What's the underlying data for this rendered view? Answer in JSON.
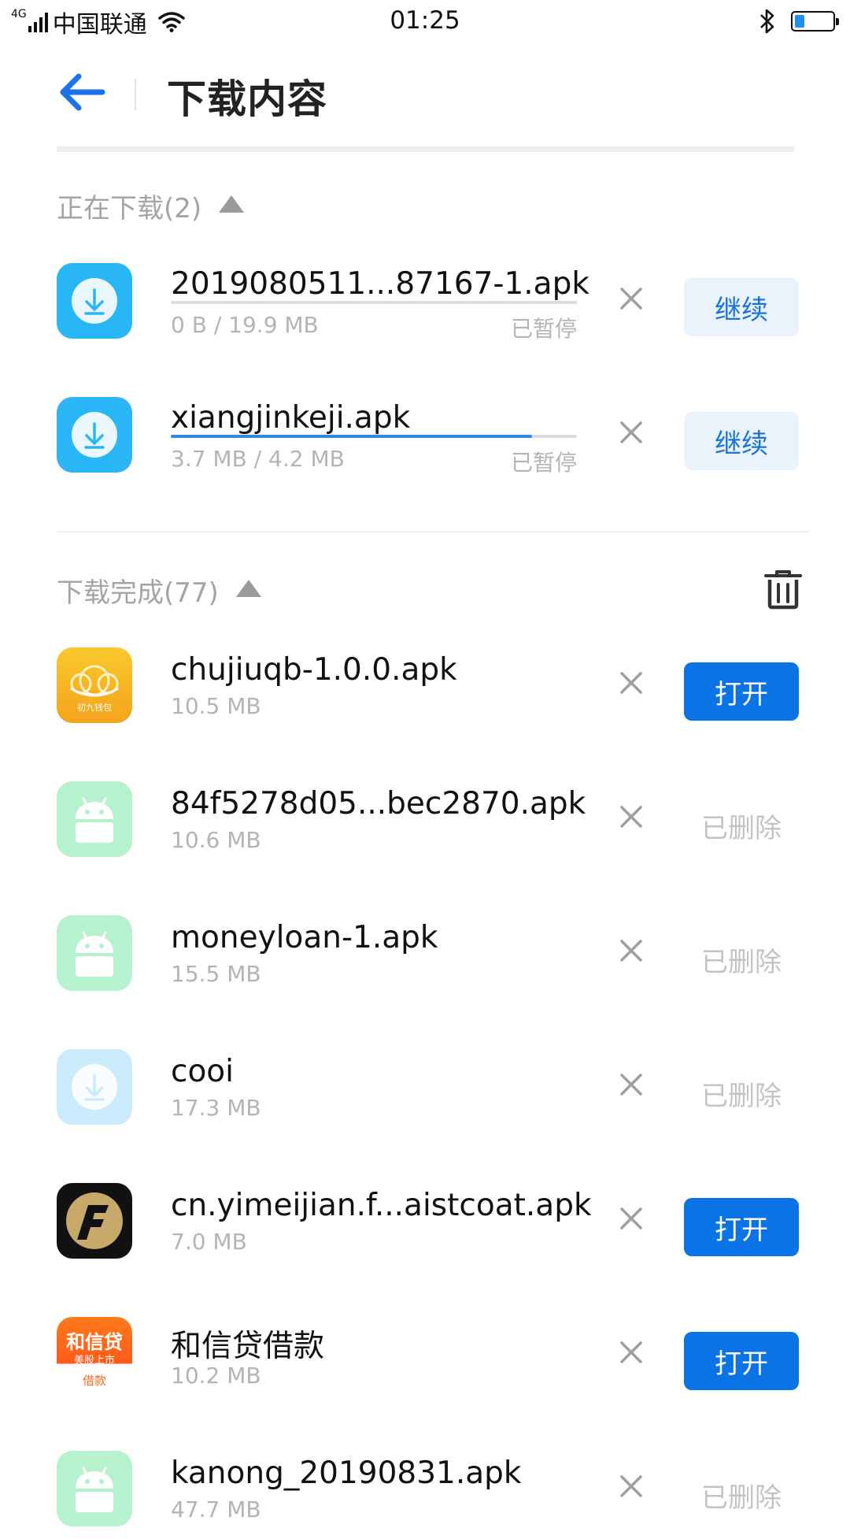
{
  "status_bar": {
    "network": "4G",
    "carrier": "中国联通",
    "time": "01:25",
    "battery_level": 0.25
  },
  "header": {
    "title": "下载内容",
    "back_icon": "arrow-left-icon"
  },
  "downloading": {
    "title": "正在下载(2)",
    "items": [
      {
        "name": "2019080511...87167-1.apk",
        "size": "0 B / 19.9 MB",
        "state": "已暂停",
        "progress": 0.0,
        "action": "继续",
        "action_type": "continue"
      },
      {
        "name": "xiangjinkeji.apk",
        "size": "3.7 MB / 4.2 MB",
        "state": "已暂停",
        "progress": 0.89,
        "action": "继续",
        "action_type": "continue"
      }
    ]
  },
  "completed": {
    "title": "下载完成(77)",
    "items": [
      {
        "name": "chujiuqb-1.0.0.apk",
        "size": "10.5 MB",
        "action": "打开",
        "action_type": "open",
        "icon": "chujiu-app-icon",
        "icon_label": "初九钱包"
      },
      {
        "name": "84f5278d05...bec2870.apk",
        "size": "10.6 MB",
        "action": "已删除",
        "action_type": "deleted",
        "icon": "android-icon"
      },
      {
        "name": "moneyloan-1.apk",
        "size": "15.5 MB",
        "action": "已删除",
        "action_type": "deleted",
        "icon": "android-icon"
      },
      {
        "name": "cooi",
        "size": "17.3 MB",
        "action": "已删除",
        "action_type": "deleted",
        "icon": "download-icon"
      },
      {
        "name": "cn.yimeijian.f...aistcoat.apk",
        "size": "7.0 MB",
        "action": "打开",
        "action_type": "open",
        "icon": "f-logo-icon"
      },
      {
        "name": "和信贷借款",
        "size": "10.2 MB",
        "action": "打开",
        "action_type": "open",
        "icon": "hexindai-icon",
        "icon_label": "和信贷",
        "icon_sub": "美股上市",
        "icon_bottom": "借款"
      },
      {
        "name": "kanong_20190831.apk",
        "size": "47.7 MB",
        "action": "已删除",
        "action_type": "deleted",
        "icon": "android-icon"
      }
    ]
  },
  "colors": {
    "accent": "#0a74e6",
    "muted": "#b4b4b4"
  }
}
